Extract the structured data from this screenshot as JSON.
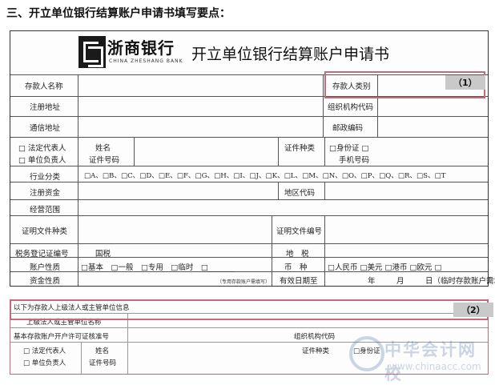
{
  "heading": "三、开立单位银行结算账户申请书填写要点：",
  "logo": {
    "name": "浙商银行",
    "sub": "CHINA ZHESHANG BANK"
  },
  "form_title": "开立单位银行结算账户申请书",
  "labels": {
    "depositor_name": "存款人名称",
    "depositor_type": "存款人类别",
    "reg_address": "注册地址",
    "org_code": "组织机构代码",
    "mail_address": "通信地址",
    "postcode": "邮政编码",
    "legal_rep": "□ 法定代表人",
    "unit_head": "□ 单位负责人",
    "name": "姓名",
    "id_type": "证件种类",
    "id_card_opt": "□身份证 □",
    "id_number": "证件号码",
    "mobile": "手机号码",
    "industry": "行业分类",
    "industry_options": "□A、□B、□C、□D、□E、□F、□G、□H、□I、□J、□K、□L、□M、□N、□O、□P、□Q、□R、□S、□T",
    "reg_capital": "注册资金",
    "area_code": "地区代码",
    "business_scope": "经营范围",
    "doc_type": "证明文件种类",
    "doc_number": "证明文件编号",
    "tax_reg": "税务登记证编号",
    "national_tax": "国税",
    "local_tax": "地　税",
    "account_nature": "账户性质",
    "account_options": "□基本　□一般　□专用　□临时　□_______",
    "currency": "币　种",
    "currency_options": "□人民币 □美元 □港币 □欧元 □",
    "fund_nature": "资金性质",
    "special_note": "（专用存款账户需填写）",
    "valid_until": "有效日期至",
    "year": "年",
    "month": "月",
    "day_note": "日（临时存款账户需填写）"
  },
  "callout1": "（1）",
  "form2": {
    "header": "以下为存款人上级法人或主管单位信息",
    "superior_name": "上级法人或主管单位名称",
    "basic_permit": "基本存款账户开户许可证核准号",
    "org_code": "组织机构代码",
    "legal_rep": "□ 法定代表人",
    "unit_head": "□ 单位负责人",
    "name": "姓名",
    "id_type": "证件种类",
    "id_card_opt": "□身份证",
    "id_number": "证件号码"
  },
  "callout2": "（2）",
  "watermark": {
    "text": "中华会计网校",
    "url": "www.chinaacc.com"
  }
}
